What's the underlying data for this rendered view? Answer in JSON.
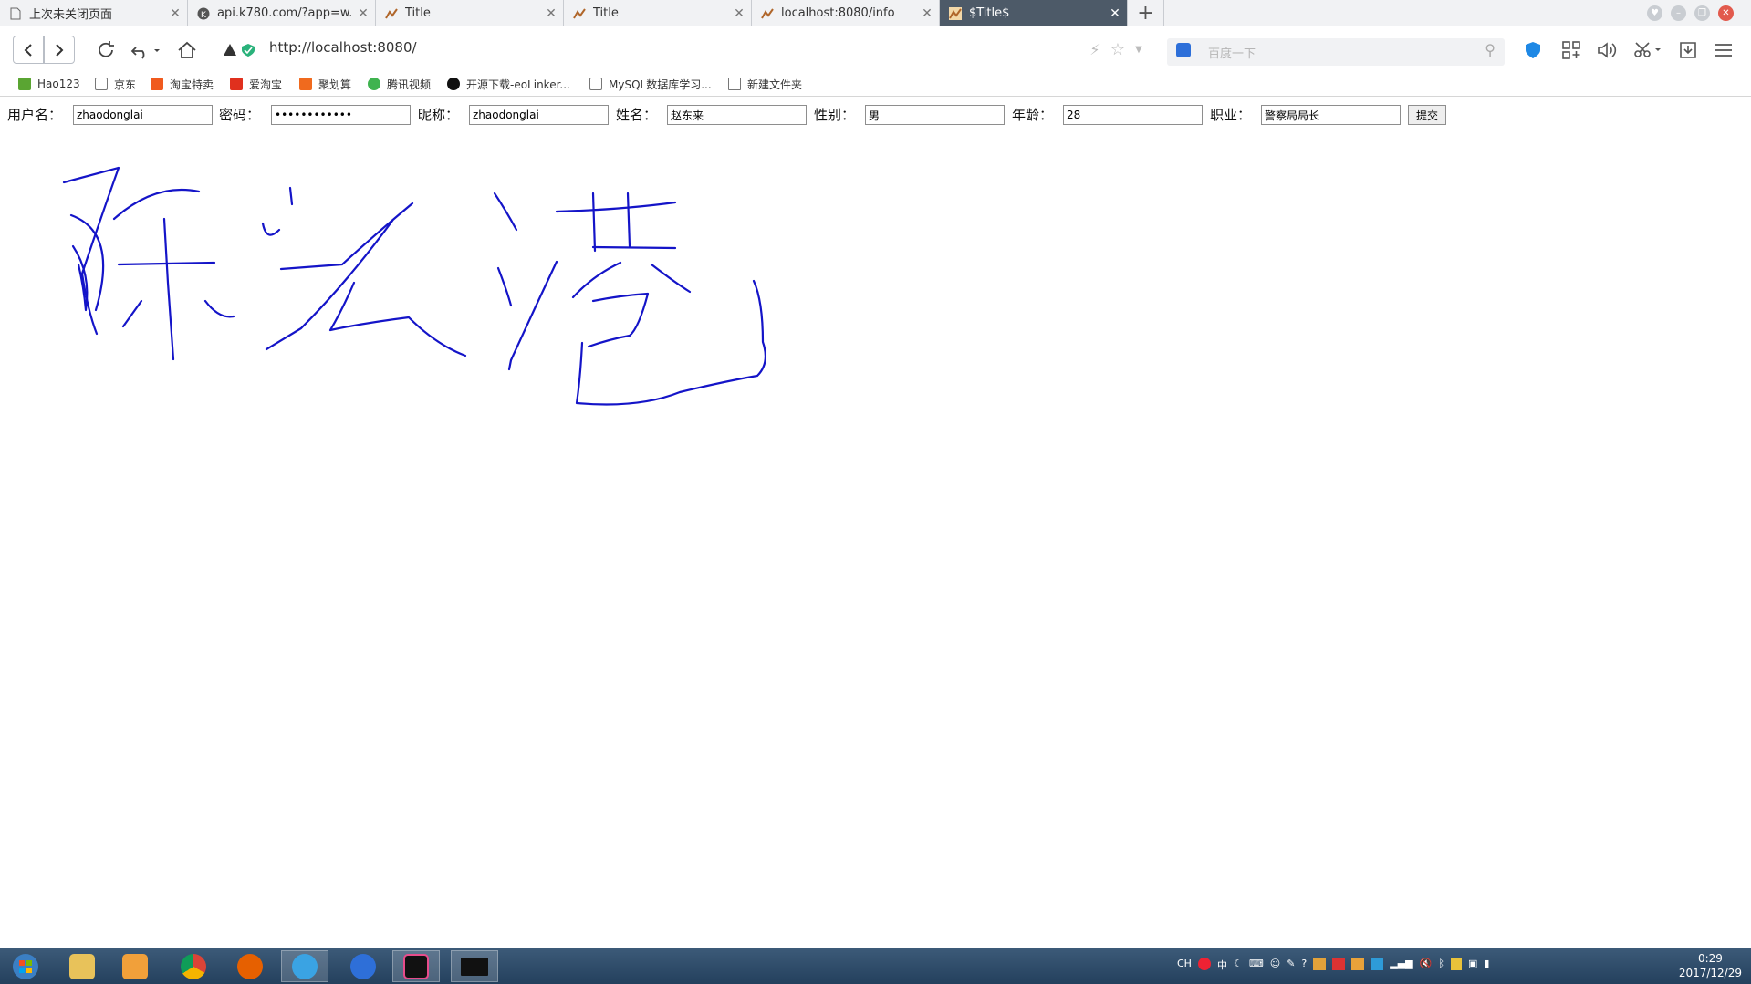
{
  "browser": {
    "tabs": [
      {
        "title": "上次未关闭页面",
        "icon": "page-icon",
        "active": false
      },
      {
        "title": "api.k780.com/?app=w...",
        "icon": "site-k-icon",
        "active": false
      },
      {
        "title": "Title",
        "icon": "intellij-icon",
        "active": false
      },
      {
        "title": "Title",
        "icon": "intellij-icon",
        "active": false
      },
      {
        "title": "localhost:8080/info",
        "icon": "intellij-icon",
        "active": false
      },
      {
        "title": "$Title$",
        "icon": "intellij-icon",
        "active": true
      }
    ],
    "new_tab_label": "+",
    "url": "http://localhost:8080/",
    "search_placeholder": "百度一下"
  },
  "bookmarks": [
    {
      "label": "Hao123",
      "color": "#5aa532"
    },
    {
      "label": "京东",
      "color": "#ffffff"
    },
    {
      "label": "淘宝特卖",
      "color": "#f05a1e"
    },
    {
      "label": "爱淘宝",
      "color": "#e0301e"
    },
    {
      "label": "聚划算",
      "color": "#f06a1e"
    },
    {
      "label": "腾讯视频",
      "color": "#3fb34f"
    },
    {
      "label": "开源下载-eoLinker...",
      "color": "#111111"
    },
    {
      "label": "MySQL数据库学习...",
      "color": "#ffffff"
    },
    {
      "label": "新建文件夹",
      "color": "#ffffff"
    }
  ],
  "form": {
    "fields": [
      {
        "label": "用户名：",
        "value": "zhaodonglai"
      },
      {
        "label": "密码：",
        "value": "••••••••••••"
      },
      {
        "label": "昵称：",
        "value": "zhaodonglai"
      },
      {
        "label": "姓名：",
        "value": "赵东来"
      },
      {
        "label": "性别：",
        "value": "男"
      },
      {
        "label": "年龄：",
        "value": "28"
      },
      {
        "label": "职业：",
        "value": "警察局局长"
      }
    ],
    "submit_label": "提交"
  },
  "drawing": {
    "stroke_color": "#1414c8"
  },
  "taskbar": {
    "tray_ime": "CH",
    "tray_lang": "中",
    "time": "0:29",
    "date": "2017/12/29"
  }
}
